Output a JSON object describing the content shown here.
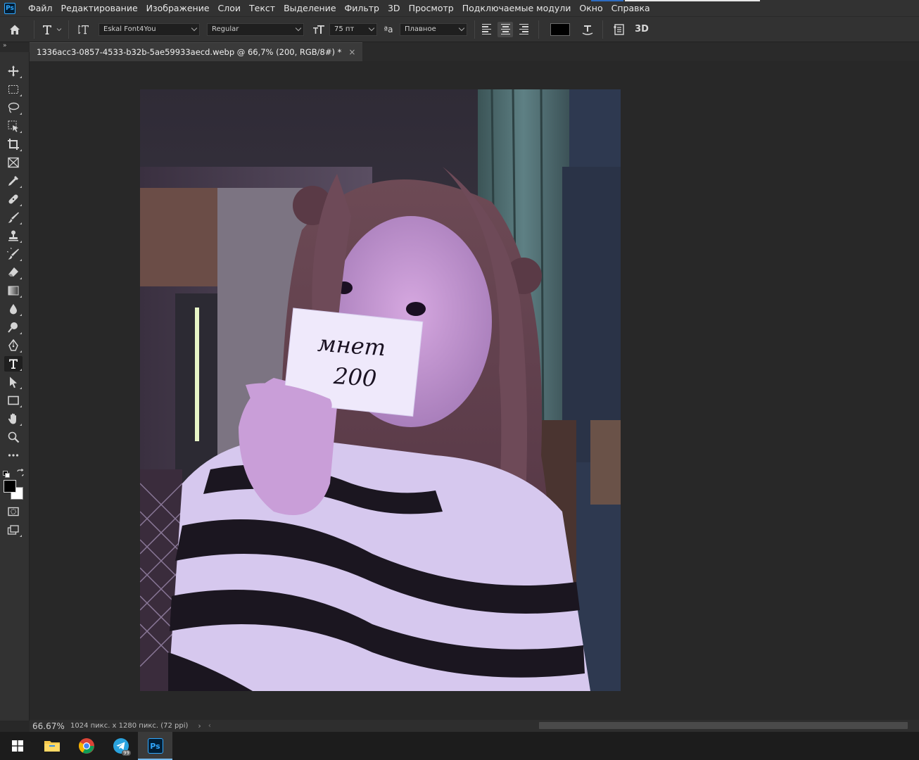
{
  "app": {
    "logo_text": "Ps",
    "menu": [
      "Файл",
      "Редактирование",
      "Изображение",
      "Слои",
      "Текст",
      "Выделение",
      "Фильтр",
      "3D",
      "Просмотр",
      "Подключаемые модули",
      "Окно",
      "Справка"
    ]
  },
  "options_bar": {
    "font_family": "Eskal Font4You",
    "font_style": "Regular",
    "font_size": "75 пт",
    "antialias_label": "ªa",
    "antialias": "Плавное",
    "text_color": "#000000",
    "label_3d": "3D"
  },
  "document": {
    "tab_title": "1336acc3-0857-4533-b32b-5ae59933aecd.webp @ 66,7% (200, RGB/8#) *",
    "close_glyph": "×",
    "card_text_line1": "мнет",
    "card_text_line2": "200"
  },
  "panel_collapse_glyph": "»",
  "status": {
    "zoom": "66.67%",
    "doc_info": "1024 пикс. x 1280 пикс. (72 ppi)",
    "arrow": "›",
    "arrow_left": "‹"
  },
  "taskbar": {
    "telegram_badge": "99",
    "ps_label": "Ps"
  },
  "colors": {
    "accent": "#31a8ff",
    "foreground": "#000000",
    "background": "#ffffff"
  }
}
